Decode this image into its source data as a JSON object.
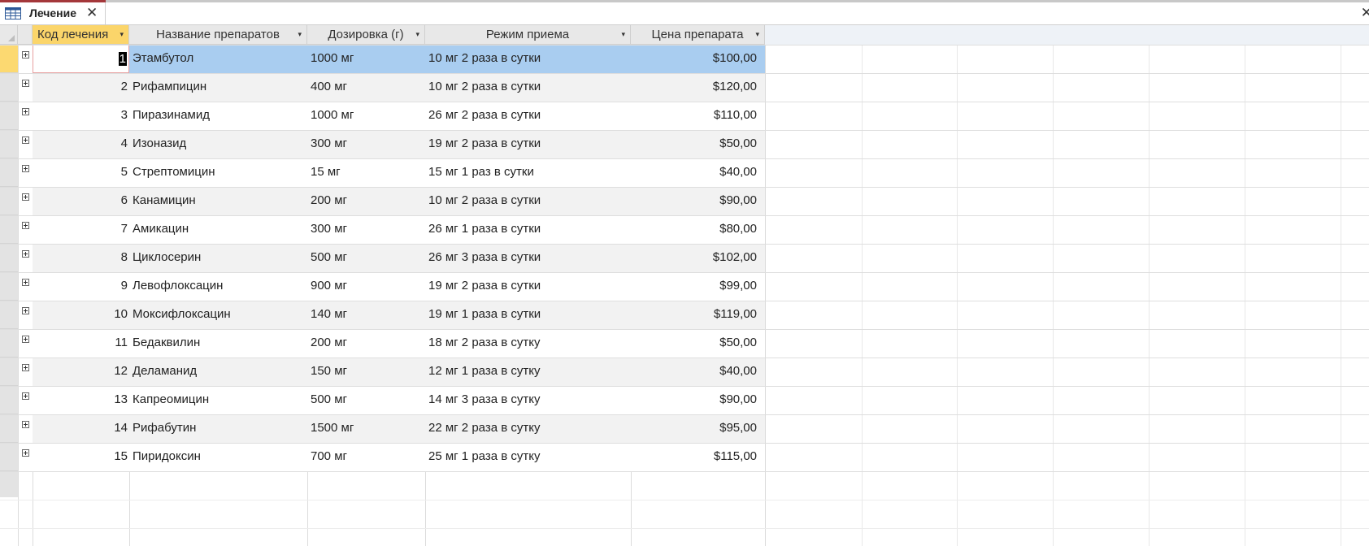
{
  "window": {
    "tab_title": "Лечение",
    "close_glyph": "✕",
    "table_icon": "table-icon"
  },
  "columns": [
    {
      "label": "Код лечения"
    },
    {
      "label": "Название препаратов"
    },
    {
      "label": "Дозировка (г)"
    },
    {
      "label": "Режим приема"
    },
    {
      "label": "Цена препарата"
    }
  ],
  "dropdown_glyph": "▾",
  "rows": [
    {
      "id": "1",
      "name": "Этамбутол",
      "dose": "1000 мг",
      "regimen": "10 мг 2 раза в сутки",
      "price": "$100,00"
    },
    {
      "id": "2",
      "name": "Рифампицин",
      "dose": "400 мг",
      "regimen": "10 мг 2 раза в сутки",
      "price": "$120,00"
    },
    {
      "id": "3",
      "name": "Пиразинамид",
      "dose": "1000 мг",
      "regimen": "26 мг 2 раза в сутки",
      "price": "$110,00"
    },
    {
      "id": "4",
      "name": "Изоназид",
      "dose": "300 мг",
      "regimen": "19 мг 2 раза в сутки",
      "price": "$50,00"
    },
    {
      "id": "5",
      "name": "Стрептомицин",
      "dose": "15 мг",
      "regimen": "15 мг 1 раз в сутки",
      "price": "$40,00"
    },
    {
      "id": "6",
      "name": "Канамицин",
      "dose": "200 мг",
      "regimen": "10 мг 2 раза в сутки",
      "price": "$90,00"
    },
    {
      "id": "7",
      "name": "Амикацин",
      "dose": "300 мг",
      "regimen": "26 мг 1 раза в сутки",
      "price": "$80,00"
    },
    {
      "id": "8",
      "name": "Циклосерин",
      "dose": "500 мг",
      "regimen": "26 мг 3 раза в сутки",
      "price": "$102,00"
    },
    {
      "id": "9",
      "name": "Левофлоксацин",
      "dose": "900 мг",
      "regimen": "19 мг 2 раза в сутки",
      "price": "$99,00"
    },
    {
      "id": "10",
      "name": "Моксифлоксацин",
      "dose": "140 мг",
      "regimen": "19 мг 1 раза в сутки",
      "price": "$119,00"
    },
    {
      "id": "11",
      "name": "Бедаквилин",
      "dose": "200 мг",
      "regimen": "18 мг 2 раза в сутку",
      "price": "$50,00"
    },
    {
      "id": "12",
      "name": "Деламанид",
      "dose": "150 мг",
      "regimen": "12 мг 1 раза в сутку",
      "price": "$40,00"
    },
    {
      "id": "13",
      "name": "Капреомицин",
      "dose": "500 мг",
      "regimen": "14 мг 3 раза в сутку",
      "price": "$90,00"
    },
    {
      "id": "14",
      "name": "Рифабутин",
      "dose": "1500 мг",
      "regimen": "22 мг 2 раза в сутку",
      "price": "$95,00"
    },
    {
      "id": "15",
      "name": "Пиридоксин",
      "dose": "700 мг",
      "regimen": "25 мг 1 раза в сутку",
      "price": "$115,00"
    }
  ],
  "colors": {
    "selected_row": "#a9cdf0",
    "active_header": "#fbd56a",
    "tab_accent": "#a4373a"
  }
}
